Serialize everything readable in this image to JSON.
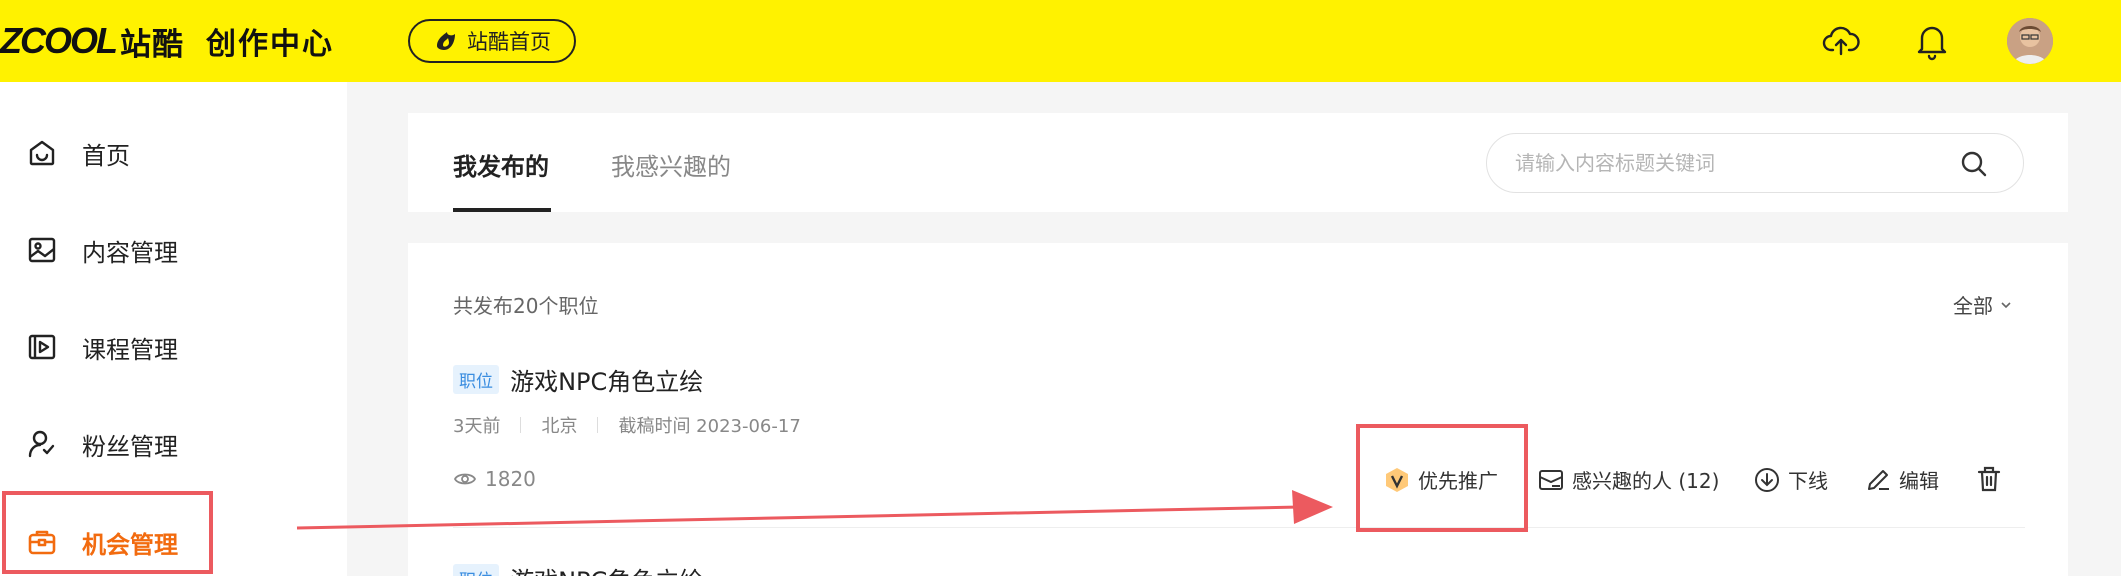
{
  "header": {
    "logo_en": "ZCOOL",
    "logo_cn": "站酷",
    "center_title": "创作中心",
    "home_button": "站酷首页",
    "upload_icon": "upload-cloud-icon",
    "bell_icon": "bell-icon",
    "brand_color": "#fff200"
  },
  "sidebar": {
    "items": [
      {
        "label": "首页",
        "icon": "home-icon"
      },
      {
        "label": "内容管理",
        "icon": "image-icon"
      },
      {
        "label": "课程管理",
        "icon": "video-course-icon"
      },
      {
        "label": "粉丝管理",
        "icon": "fans-icon"
      },
      {
        "label": "机会管理",
        "icon": "briefcase-icon",
        "active": true
      }
    ],
    "active_color": "#f26b0f"
  },
  "tabs": [
    {
      "label": "我发布的",
      "active": true
    },
    {
      "label": "我感兴趣的",
      "active": false
    }
  ],
  "search": {
    "placeholder": "请输入内容标题关键词"
  },
  "list": {
    "total_text": "共发布20个职位",
    "filter_label": "全部",
    "jobs": [
      {
        "tag": "职位",
        "title": "游戏NPC角色立绘",
        "time_ago": "3天前",
        "city": "北京",
        "deadline": "截稿时间 2023-06-17",
        "views": "1820",
        "actions": {
          "promote": "优先推广",
          "interested": "感兴趣的人 (12)",
          "offline": "下线",
          "edit": "编辑"
        }
      },
      {
        "tag": "职位",
        "title": "游戏NPC角色立绘"
      }
    ]
  },
  "annotation_color": "#ec5a5f"
}
